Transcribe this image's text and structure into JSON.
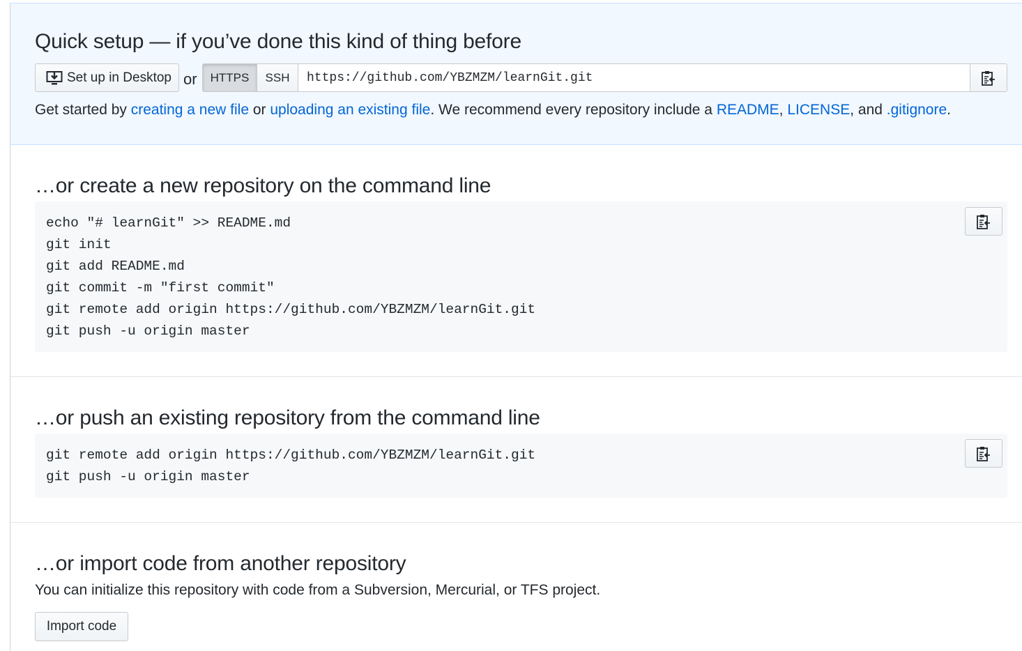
{
  "quick_setup": {
    "title": "Quick setup — if you’ve done this kind of thing before",
    "desktop_button": "Set up in Desktop",
    "or_text": "or",
    "protocols": [
      {
        "label": "HTTPS",
        "selected": true
      },
      {
        "label": "SSH",
        "selected": false
      }
    ],
    "clone_url": "https://github.com/YBZMZM/learnGit.git",
    "hint": {
      "prefix": "Get started by ",
      "link_new_file": "creating a new file",
      "mid1": " or ",
      "link_upload": "uploading an existing file",
      "mid2": ". We recommend every repository include a ",
      "link_readme": "README",
      "comma1": ", ",
      "link_license": "LICENSE",
      "mid3": ", and ",
      "link_gitignore": ".gitignore",
      "suffix": "."
    }
  },
  "create_section": {
    "title": "…or create a new repository on the command line",
    "code": "echo \"# learnGit\" >> README.md\ngit init\ngit add README.md\ngit commit -m \"first commit\"\ngit remote add origin https://github.com/YBZMZM/learnGit.git\ngit push -u origin master"
  },
  "push_section": {
    "title": "…or push an existing repository from the command line",
    "code": "git remote add origin https://github.com/YBZMZM/learnGit.git\ngit push -u origin master"
  },
  "import_section": {
    "title": "…or import code from another repository",
    "description": "You can initialize this repository with code from a Subversion, Mercurial, or TFS project.",
    "button": "Import code"
  },
  "icons": {
    "desktop": "desktop-download-icon",
    "copy": "clippy-icon"
  },
  "colors": {
    "link": "#0366d6",
    "quick_bg": "#f1f8ff",
    "code_bg": "#f6f8fa"
  }
}
